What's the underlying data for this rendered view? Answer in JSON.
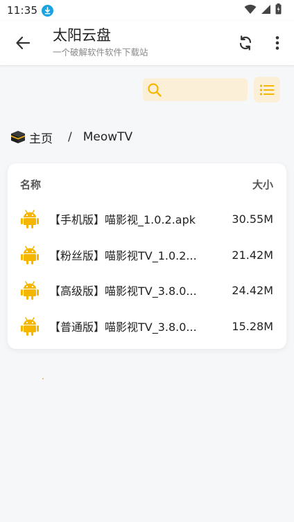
{
  "status_bar": {
    "time": "11:35",
    "icons": [
      "download-icon",
      "wifi-icon",
      "signal-icon",
      "battery-icon"
    ]
  },
  "app_bar": {
    "title": "太阳云盘",
    "subtitle": "一个破解软件软件下载站",
    "icons": [
      "back-arrow-icon",
      "refresh-icon",
      "more-vert-icon"
    ]
  },
  "search": {
    "value": "",
    "placeholder": ""
  },
  "breadcrumb": {
    "home_label": "主页",
    "separator": "/",
    "current": "MeowTV"
  },
  "file_table": {
    "columns": {
      "name": "名称",
      "size": "大小"
    },
    "files": [
      {
        "name": "【手机版】喵影视_1.0.2.apk",
        "size": "30.55M",
        "icon": "android-icon"
      },
      {
        "name": "【粉丝版】喵影视TV_1.0.2...",
        "size": "21.42M",
        "icon": "android-icon"
      },
      {
        "name": "【高级版】喵影视TV_3.8.0...",
        "size": "24.42M",
        "icon": "android-icon"
      },
      {
        "name": "【普通版】喵影视TV_3.8.0...",
        "size": "15.28M",
        "icon": "android-icon"
      }
    ]
  },
  "colors": {
    "accent": "#f5b600",
    "accent_bg": "#fcefd7",
    "background": "#f6f7f9",
    "download_badge": "#1aa3e0"
  }
}
